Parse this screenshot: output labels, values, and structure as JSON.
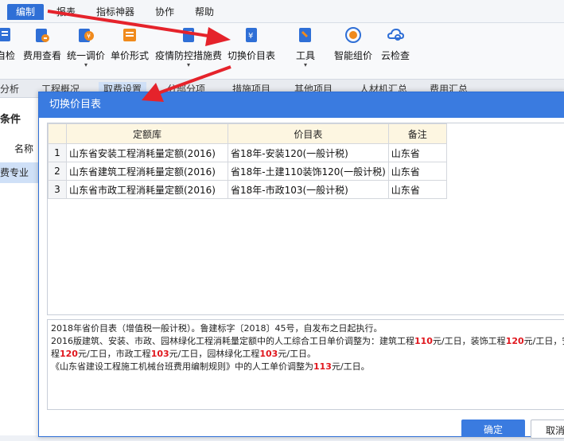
{
  "menu": {
    "items": [
      {
        "label": "编制",
        "active": true
      },
      {
        "label": "报表"
      },
      {
        "label": "指标神器"
      },
      {
        "label": "协作"
      },
      {
        "label": "帮助"
      }
    ]
  },
  "toolbar": {
    "items": [
      {
        "label": "自检",
        "icon": "self-check-icon"
      },
      {
        "label": "费用查看",
        "icon": "fee-view-icon"
      },
      {
        "label": "统一调价",
        "icon": "unified-price-icon"
      },
      {
        "label": "单价形式",
        "icon": "unit-price-icon"
      },
      {
        "label": "疫情防控措施费",
        "icon": "epidemic-fee-icon"
      },
      {
        "label": "切换价目表",
        "icon": "switch-pricelist-icon"
      },
      {
        "label": "工具",
        "icon": "tools-icon"
      },
      {
        "label": "智能组价",
        "icon": "smart-pricing-icon"
      },
      {
        "label": "云检查",
        "icon": "cloud-check-icon"
      }
    ]
  },
  "tabs": [
    {
      "label": "分析"
    },
    {
      "label": "工程概况"
    },
    {
      "label": "取费设置",
      "selected": true
    },
    {
      "label": "分部分项"
    },
    {
      "label": "措施项目"
    },
    {
      "label": "其他项目"
    },
    {
      "label": "人材机汇总"
    },
    {
      "label": "费用汇总"
    }
  ],
  "left_panel": {
    "title": "条件",
    "column_name": "名称",
    "selected_item": "费专业"
  },
  "dialog": {
    "title": "切换价目表",
    "columns": [
      "定额库",
      "价目表",
      "备注"
    ],
    "rows": [
      {
        "index": "1",
        "quota": "山东省安装工程消耗量定额(2016)",
        "pricelist": "省18年-安装120(一般计税)",
        "note": "山东省"
      },
      {
        "index": "2",
        "quota": "山东省建筑工程消耗量定额(2016)",
        "pricelist": "省18年-土建110装饰120(一般计税)",
        "note": "山东省"
      },
      {
        "index": "3",
        "quota": "山东省市政工程消耗量定额(2016)",
        "pricelist": "省18年-市政103(一般计税)",
        "note": "山东省"
      }
    ],
    "description": {
      "line1": "2018年省价目表（增值税一般计税）。鲁建标字〔2018〕45号，自发布之日起执行。",
      "line2_a": "2016版建筑、安装、市政、园林绿化工程消耗量定额中的人工综合工日单价调整为：建筑工程",
      "line2_v1": "110",
      "line2_b": "元/工日，装饰工程",
      "line2_v2": "120",
      "line2_c": "元/工日，安",
      "line3_a": "程",
      "line3_v1": "120",
      "line3_b": "元/工日，市政工程",
      "line3_v2": "103",
      "line3_c": "元/工日，园林绿化工程",
      "line3_v3": "103",
      "line3_d": "元/工日。",
      "line4_a": "《山东省建设工程施工机械台班费用编制规则》中的人工单价调整为",
      "line4_v1": "113",
      "line4_b": "元/工日。"
    },
    "ok_label": "确定",
    "cancel_label": "取消"
  },
  "colors": {
    "accent": "#3a7be0",
    "annotation_arrow": "#e5232b",
    "highlight_value": "#e0161d"
  }
}
